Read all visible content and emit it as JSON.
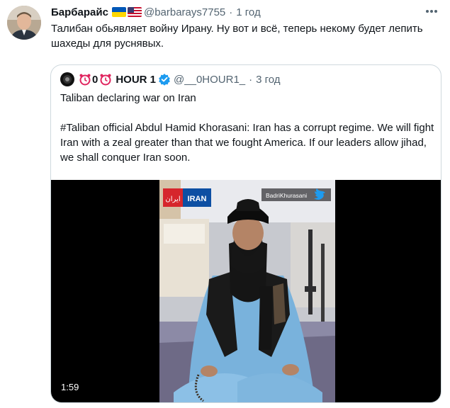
{
  "tweet": {
    "display_name": "Барбарайс",
    "flags": [
      "ukraine-flag",
      "usa-flag"
    ],
    "handle": "@barbarays7755",
    "separator": "·",
    "time": "1 год",
    "text": "Талибан обьявляет войну Ирану. Ну вот и всё, теперь некому будет лепить шахеды для руснявых."
  },
  "quote": {
    "name_prefix": "0",
    "name": "HOUR 1",
    "handle": "@__0HOUR1_",
    "separator": "·",
    "time": "3 год",
    "line1": "Taliban declaring war on Iran",
    "line2": "#Taliban official Abdul Hamid Khorasani: Iran has a corrupt regime. We will fight Iran with a zeal greater than that we fought America. If our leaders allow jihad, we shall conquer Iran soon.",
    "video": {
      "duration": "1:59",
      "logo_text": "IRAN",
      "logo_script": "ایران",
      "watermark": "BadriKhurasani"
    }
  },
  "colors": {
    "text": "#0f1419",
    "secondary": "#536471",
    "border": "#cfd9de",
    "verified": "#1d9bf0",
    "alarm": "#e0245e"
  }
}
